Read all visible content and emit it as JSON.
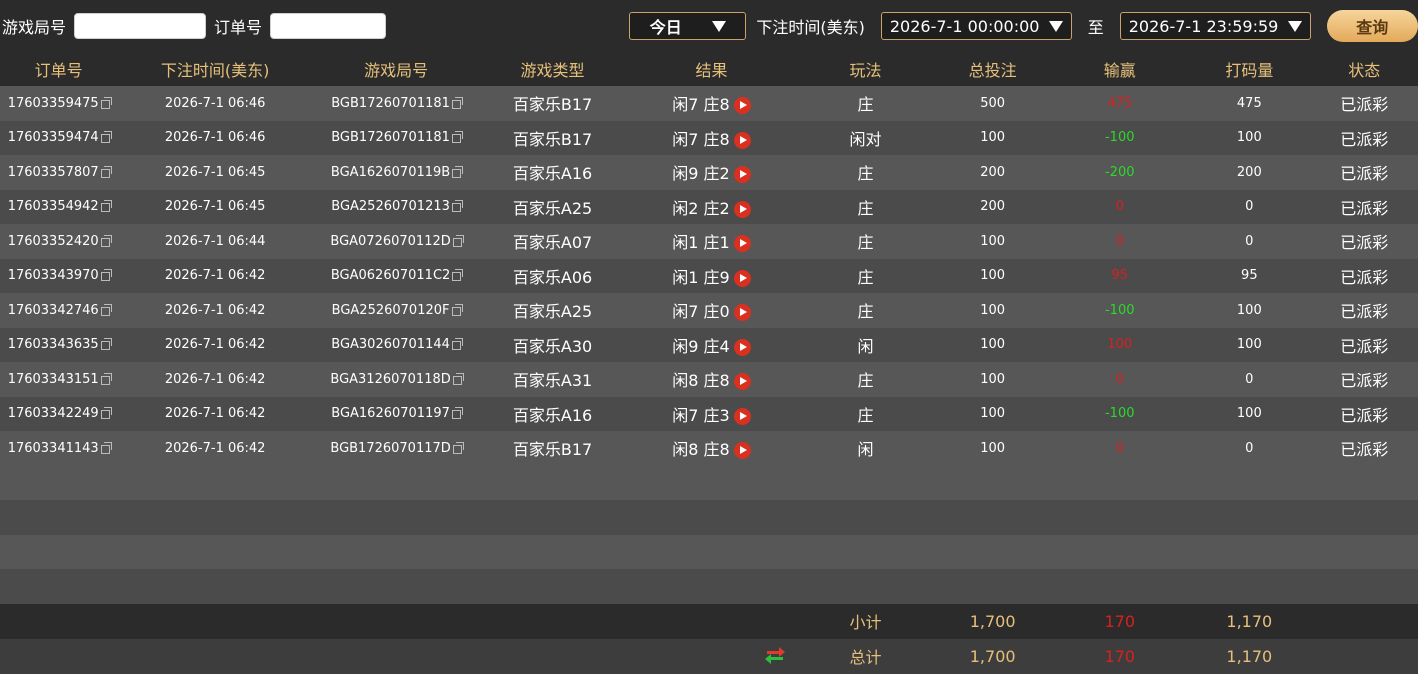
{
  "filters": {
    "game_round_label": "游戏局号",
    "game_round_value": "",
    "order_no_label": "订单号",
    "order_no_value": "",
    "range_select": "今日",
    "bet_time_label": "下注时间(美东)",
    "start_time": "2026-7-1 00:00:00",
    "to_label": "至",
    "end_time": "2026-7-1 23:59:59",
    "query_button": "查询"
  },
  "columns": [
    "订单号",
    "下注时间(美东)",
    "游戏局号",
    "游戏类型",
    "结果",
    "玩法",
    "总投注",
    "输赢",
    "打码量",
    "状态"
  ],
  "rows": [
    {
      "order": "17603359475",
      "time": "2026-7-1 06:46",
      "round": "BGB17260701181",
      "game": "百家乐B17",
      "result": "闲7 庄8",
      "play": "庄",
      "bet": "500",
      "win": "475",
      "win_type": "pos",
      "code": "475",
      "status": "已派彩"
    },
    {
      "order": "17603359474",
      "time": "2026-7-1 06:46",
      "round": "BGB17260701181",
      "game": "百家乐B17",
      "result": "闲7 庄8",
      "play": "闲对",
      "bet": "100",
      "win": "-100",
      "win_type": "neg",
      "code": "100",
      "status": "已派彩"
    },
    {
      "order": "17603357807",
      "time": "2026-7-1 06:45",
      "round": "BGA1626070119B",
      "game": "百家乐A16",
      "result": "闲9 庄2",
      "play": "庄",
      "bet": "200",
      "win": "-200",
      "win_type": "neg",
      "code": "200",
      "status": "已派彩"
    },
    {
      "order": "17603354942",
      "time": "2026-7-1 06:45",
      "round": "BGA25260701213",
      "game": "百家乐A25",
      "result": "闲2 庄2",
      "play": "庄",
      "bet": "200",
      "win": "0",
      "win_type": "zero",
      "code": "0",
      "status": "已派彩"
    },
    {
      "order": "17603352420",
      "time": "2026-7-1 06:44",
      "round": "BGA0726070112D",
      "game": "百家乐A07",
      "result": "闲1 庄1",
      "play": "庄",
      "bet": "100",
      "win": "0",
      "win_type": "zero",
      "code": "0",
      "status": "已派彩"
    },
    {
      "order": "17603343970",
      "time": "2026-7-1 06:42",
      "round": "BGA062607011C2",
      "game": "百家乐A06",
      "result": "闲1 庄9",
      "play": "庄",
      "bet": "100",
      "win": "95",
      "win_type": "pos",
      "code": "95",
      "status": "已派彩"
    },
    {
      "order": "17603342746",
      "time": "2026-7-1 06:42",
      "round": "BGA2526070120F",
      "game": "百家乐A25",
      "result": "闲7 庄0",
      "play": "庄",
      "bet": "100",
      "win": "-100",
      "win_type": "neg",
      "code": "100",
      "status": "已派彩"
    },
    {
      "order": "17603343635",
      "time": "2026-7-1 06:42",
      "round": "BGA30260701144",
      "game": "百家乐A30",
      "result": "闲9 庄4",
      "play": "闲",
      "bet": "100",
      "win": "100",
      "win_type": "pos",
      "code": "100",
      "status": "已派彩"
    },
    {
      "order": "17603343151",
      "time": "2026-7-1 06:42",
      "round": "BGA3126070118D",
      "game": "百家乐A31",
      "result": "闲8 庄8",
      "play": "庄",
      "bet": "100",
      "win": "0",
      "win_type": "zero",
      "code": "0",
      "status": "已派彩"
    },
    {
      "order": "17603342249",
      "time": "2026-7-1 06:42",
      "round": "BGA16260701197",
      "game": "百家乐A16",
      "result": "闲7 庄3",
      "play": "庄",
      "bet": "100",
      "win": "-100",
      "win_type": "neg",
      "code": "100",
      "status": "已派彩"
    },
    {
      "order": "17603341143",
      "time": "2026-7-1 06:42",
      "round": "BGB1726070117D",
      "game": "百家乐B17",
      "result": "闲8 庄8",
      "play": "闲",
      "bet": "100",
      "win": "0",
      "win_type": "zero",
      "code": "0",
      "status": "已派彩"
    }
  ],
  "subtotal": {
    "label": "小计",
    "bet": "1,700",
    "win": "170",
    "code": "1,170"
  },
  "total": {
    "label": "总计",
    "bet": "1,700",
    "win": "170",
    "code": "1,170"
  },
  "colors": {
    "accent": "#e6c07a",
    "loss": "#2bd92b",
    "gain": "#d9201f"
  }
}
